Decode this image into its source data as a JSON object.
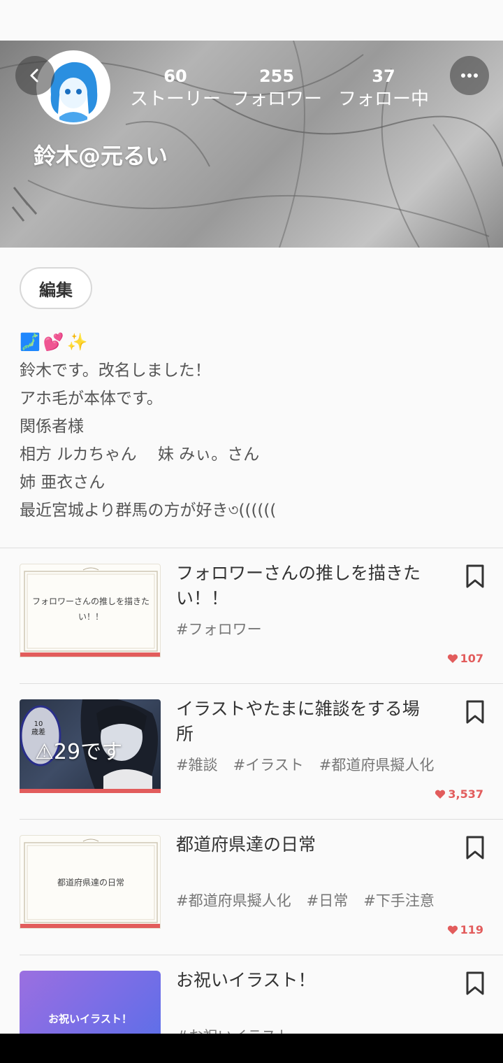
{
  "profile": {
    "username": "鈴木@元るい",
    "stats": [
      {
        "count": "60",
        "label": "ストーリー"
      },
      {
        "count": "255",
        "label": "フォロワー"
      },
      {
        "count": "37",
        "label": "フォロー中"
      }
    ],
    "edit_label": "編集",
    "bio_emoji": [
      "🗾",
      "💕",
      "✨"
    ],
    "bio_lines": [
      "鈴木です。改名しました！",
      "アホ毛が本体です。",
      "関係者様",
      "相方 ルカちゃん　 妹 みぃ。さん",
      "姉 亜衣さん",
      "最近宮城より群馬の方が好き৩(((((("
    ]
  },
  "stories": [
    {
      "title": "フォロワーさんの推しを描きたい！！",
      "thumb_text": "フォロワーさんの推しを描きたい！！",
      "tags": [
        "#フォロワー"
      ],
      "likes": "107"
    },
    {
      "title": "イラストやたまに雑談をする場所",
      "thumb_text": "⚠29です",
      "thumb_badge": "10歳差",
      "tags": [
        "#雑談",
        "#イラスト",
        "#都道府県擬人化"
      ],
      "likes": "3,537"
    },
    {
      "title": "都道府県達の日常",
      "thumb_text": "都道府県達の日常",
      "tags": [
        "#都道府県擬人化",
        "#日常",
        "#下手注意"
      ],
      "likes": "119"
    },
    {
      "title": "お祝いイラスト！",
      "thumb_text": "お祝いイラスト！",
      "tags": [
        "#お祝いイラスト"
      ],
      "likes": ""
    }
  ],
  "colors": {
    "accent": "#e25c5c",
    "bg": "#fafafa"
  }
}
